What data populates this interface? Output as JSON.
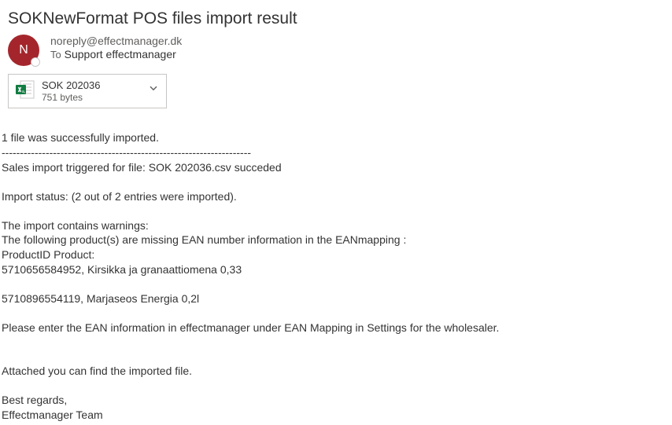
{
  "email": {
    "subject": "SOKNewFormat POS files import result",
    "avatar_initial": "N",
    "from": "noreply@effectmanager.dk",
    "to_label": "To",
    "to": "Support effectmanager",
    "attachment": {
      "name": "SOK 202036",
      "size": "751 bytes"
    }
  },
  "body": {
    "line1": "1 file was successfully imported.",
    "divider": "--------------------------------------------------------------------",
    "line2a": "Sales import triggered for file:",
    "line2b": "SOK 202036.csv",
    "line2c": "succeded",
    "status": " Import status: (2 out of 2 entries were imported).",
    "warnings_header": "The import contains warnings:",
    "warnings_intro": "The following product(s) are missing EAN number information in the EANmapping :",
    "product_header": " ProductID Product:",
    "product1_id": "5710656584952,",
    "product1_name": " Kirsikka ja granaattiomena 0,33",
    "product2_id": "5710896554119,",
    "product2_name": "Marjaseos Energia 0,2l",
    "instruction": "Please enter the EAN information in effectmanager under EAN Mapping in Settings for the wholesaler.",
    "attached_note": "Attached you can find the imported file.",
    "regards": " Best regards,",
    "signature": "Effectmanager Team"
  }
}
